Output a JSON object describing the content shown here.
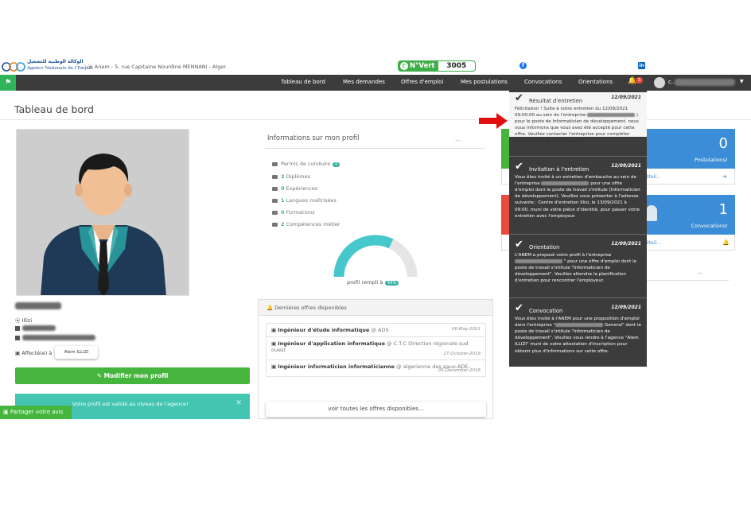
{
  "header": {
    "logo_arabic": "الوكالة الوطنية للتشغيل",
    "logo_french": "Agence Nationale de l'Emploi",
    "address": "Anem - 5, rue Capitaine Nourdine MENNANI - Alger.",
    "nvert_label": "N°Vert",
    "nvert_number": "3005"
  },
  "nav": {
    "items": [
      "Tableau de bord",
      "Mes demandes",
      "Offres d'emploi",
      "Mes postulations",
      "Convocations",
      "Orientations"
    ],
    "notification_count": "3",
    "user_email": "c...@w....dz"
  },
  "page": {
    "title": "Tableau de bord"
  },
  "profile": {
    "city": "Illizi",
    "affecte_label": "Affecté(e) à",
    "agency": "Alem ILLIZI",
    "modify_button": "Modifier mon profil",
    "validated_msg": "Votre profil est validé au niveau de l'agence!",
    "share_label": "Partager votre avis"
  },
  "info": {
    "title": "Informations sur mon profil",
    "rows": [
      {
        "count": "",
        "label": "Permis de conduire",
        "pill": "0"
      },
      {
        "count": "2",
        "label": "Diplômes",
        "pill": ""
      },
      {
        "count": "0",
        "label": "Expériences",
        "pill": ""
      },
      {
        "count": "1",
        "label": "Langues maîtrisées",
        "pill": ""
      },
      {
        "count": "0",
        "label": "Formations",
        "pill": ""
      },
      {
        "count": "2",
        "label": "Compétences métier",
        "pill": ""
      }
    ],
    "profile_fill_label": "profil rempli à",
    "profile_fill_percent": "64%",
    "profile_fill_value": 0.64
  },
  "offers": {
    "title": "Dernières offres disponibles",
    "items": [
      {
        "title": "Ingénieur d'étude informatique",
        "company": "ADS",
        "date": "06-May-2021"
      },
      {
        "title": "Ingénieur d'application informatique",
        "company": "C.T.C Direction régionale sud ouest",
        "date": "17-October-2019"
      },
      {
        "title": "Ingénieur informaticien informaticienne",
        "company": "algerienne des eaux-ADE-",
        "date": "05-December-2018"
      }
    ],
    "see_all": "voir toutes les offres disponibles..."
  },
  "cards": {
    "postulations_count": "0",
    "postulations_label": "Postulations!",
    "convocations_count": "1",
    "convocations_label": "Convocations!",
    "details_link": "étail..."
  },
  "notifications": [
    {
      "type": "Résultat d'entretien",
      "date": "12/09/2021",
      "body_1": "Félicitation ! Suite à votre entretien du 12/09/2021 09:00:00 au sein de l'entreprise",
      "body_2": ") pour le poste de Informaticien de développement, nous vous informons que vous avez été accepté pour cette offre. Veuillez contacter l'entreprise pour compléter votre dossier de recrutement."
    },
    {
      "type": "Invitation à l'entretien",
      "date": "12/09/2021",
      "body_1": "Vous êtes invité à un entretien d'embauche au sein de l'entreprise",
      "body_2": "pour une offre d'emploi dont le poste de travail s'intitule (Informaticien de développement). Veuillez vous présenter à l'adresse suivante : Centre d'entretien Illizi, le 13/09/2021 à 09:00, muni de votre pièce d'identité, pour passer votre entretien avec l'employeur."
    },
    {
      "type": "Orientation",
      "date": "12/09/2021",
      "body_1": "L'ANEM a proposé votre profil à l'entreprise",
      "body_2": "\" pour une offre d'emploi dont le poste de travail s'intitule \"Informaticien de développement\". Veuillez attendre la planification d'entretien pour rencontrer l'employeur."
    },
    {
      "type": "Convocation",
      "date": "12/09/2021",
      "body_1": "Vous êtes invité à l'ANEM pour une proposition d'emploi dans l'entreprise \"",
      "body_2": "General\" dont le poste de travail s'intitule \"Informaticien de développement\". Veuillez vous rendre à l'agence \"Alem ILLIZI\" muni de votre attestation d'inscription pour obtenir plus d'informations sur cette offre."
    }
  ],
  "colors": {
    "nav_bg": "#3c3c3c",
    "accent_green": "#46b53d",
    "accent_teal": "#3ab0a2",
    "card_blue": "#3a8dd6",
    "alert_red": "#e74c3c"
  }
}
